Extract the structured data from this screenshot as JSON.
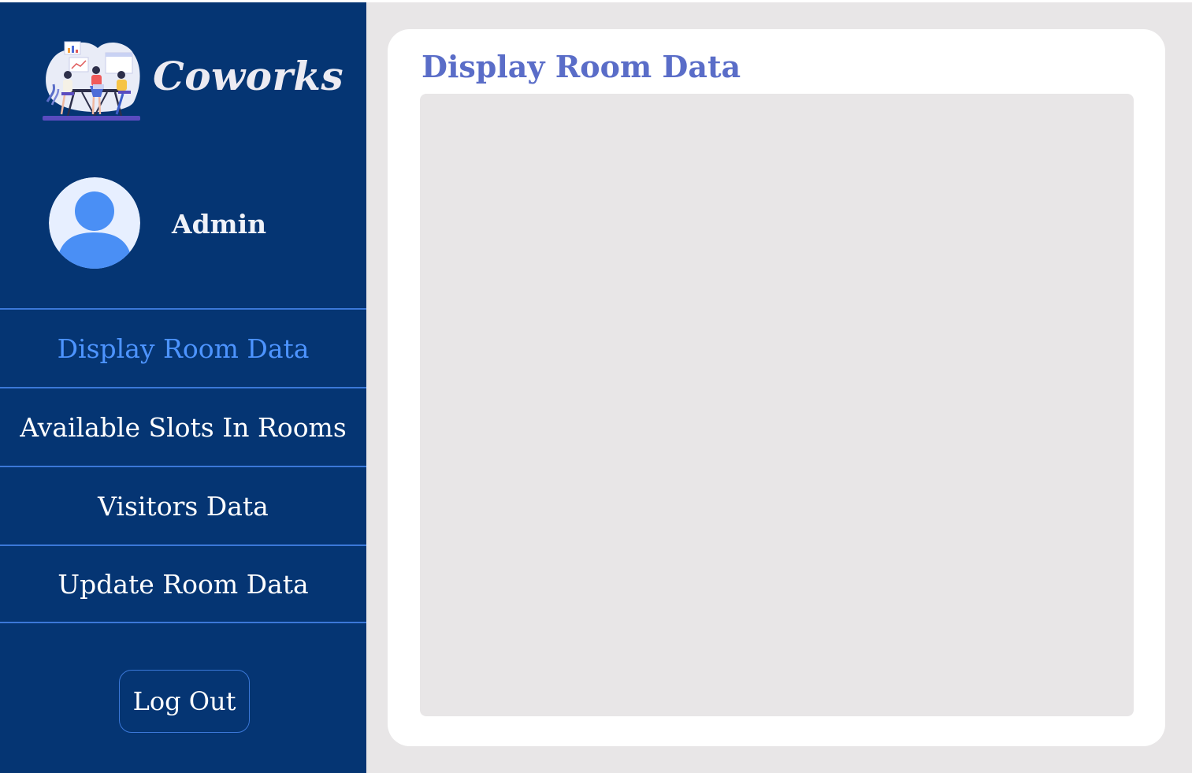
{
  "app": {
    "name": "Coworks"
  },
  "profile": {
    "name": "Admin"
  },
  "nav": {
    "items": [
      {
        "label": "Display Room Data"
      },
      {
        "label": "Available Slots In Rooms"
      },
      {
        "label": "Visitors Data"
      },
      {
        "label": "Update Room Data"
      }
    ],
    "logout_label": "Log Out"
  },
  "main": {
    "title": "Display Room Data"
  },
  "colors": {
    "sidebar_bg": "#053573",
    "active_nav": "#4d94ff",
    "divider": "#3b78d8",
    "title": "#5a6dc8",
    "page_bg": "#e8e6e7"
  },
  "icons": {
    "logo": "coworkers-illustration-logo",
    "avatar": "user-avatar-icon"
  }
}
